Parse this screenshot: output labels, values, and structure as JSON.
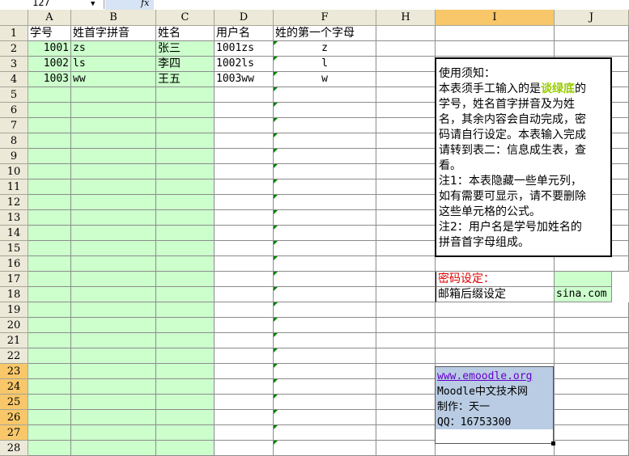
{
  "formula_bar": {
    "name_box": "127",
    "fx_label": "fx"
  },
  "columns": [
    "A",
    "B",
    "C",
    "D",
    "F",
    "H",
    "I",
    "J"
  ],
  "selected_column": "I",
  "selected_rows": [
    "23",
    "24",
    "25",
    "26",
    "27"
  ],
  "rows": [
    "1",
    "2",
    "3",
    "4",
    "5",
    "6",
    "7",
    "8",
    "9",
    "10",
    "11",
    "12",
    "13",
    "14",
    "15",
    "16",
    "17",
    "18",
    "19",
    "20",
    "21",
    "22",
    "23",
    "24",
    "25",
    "26",
    "27",
    "28"
  ],
  "headers": {
    "a": "学号",
    "b": "姓首字拼音",
    "c": "姓名",
    "d": "用户名",
    "f": "姓的第一个字母"
  },
  "records": [
    {
      "id": "1001",
      "initials": "zs",
      "name": "张三",
      "username": "1001zs",
      "letter": "z"
    },
    {
      "id": "1002",
      "initials": "ls",
      "name": "李四",
      "username": "1002ls",
      "letter": "l"
    },
    {
      "id": "1003",
      "initials": "ww",
      "name": "王五",
      "username": "1003ww",
      "letter": "w"
    }
  ],
  "notes": {
    "l1": "使用须知：",
    "l2a": "本表须手工输入的是",
    "l2hl": "谈绿底",
    "l2b": "的",
    "l3": "学号，姓名首字拼音及为姓",
    "l4": "名，其余内容会自动完成，密",
    "l5": "码请自行设定。本表输入完成",
    "l6": "请转到表二：信息成生表，查",
    "l7": "看。",
    "l8": "注1：本表隐藏一些单元列，",
    "l9": "如有需要可显示，请不要删除",
    "l10": "这些单元格的公式。",
    "l11": "注2：用户名是学号加姓名的",
    "l12": "拼音首字母组成。"
  },
  "settings": {
    "password_label": "密码设定：",
    "mail_label": "邮箱后缀设定",
    "mail_value": "sina.com"
  },
  "credit": {
    "url": "www.emoodle.org",
    "site": "Moodle中文技术网",
    "author": "制作：天一",
    "qq": "QQ：16753300"
  },
  "colors": {
    "green_fill": "#ccffcc",
    "selected_header": "#f8c76a",
    "credit_fill": "#b9cce4",
    "highlight_text": "#99cc00",
    "password_text": "#dd0000"
  }
}
